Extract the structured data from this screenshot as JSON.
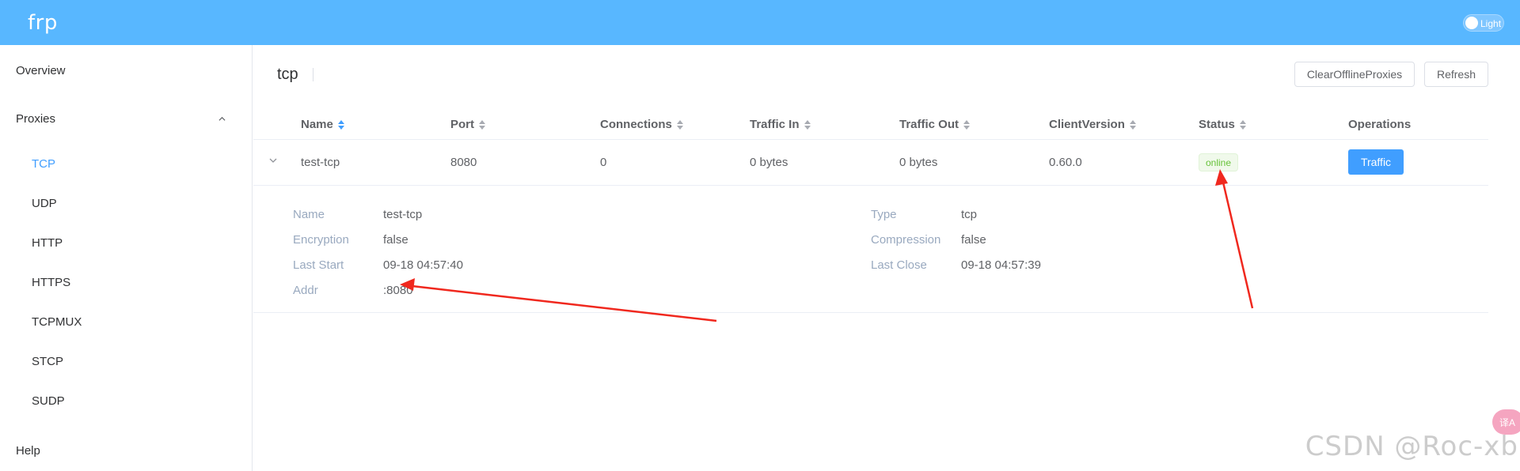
{
  "header": {
    "brand": "frp",
    "theme_toggle_label": "Light"
  },
  "sidebar": {
    "overview": "Overview",
    "proxies": "Proxies",
    "proxy_types": [
      "TCP",
      "UDP",
      "HTTP",
      "HTTPS",
      "TCPMUX",
      "STCP",
      "SUDP"
    ],
    "active_type": "TCP",
    "help": "Help"
  },
  "page": {
    "title": "tcp",
    "clear_button": "ClearOfflineProxies",
    "refresh_button": "Refresh"
  },
  "table": {
    "columns": [
      "Name",
      "Port",
      "Connections",
      "Traffic In",
      "Traffic Out",
      "ClientVersion",
      "Status",
      "Operations"
    ],
    "rows": [
      {
        "name": "test-tcp",
        "port": "8080",
        "connections": "0",
        "traffic_in": "0 bytes",
        "traffic_out": "0 bytes",
        "client_version": "0.60.0",
        "status": "online",
        "operation": "Traffic"
      }
    ]
  },
  "details": {
    "name_label": "Name",
    "name_value": "test-tcp",
    "type_label": "Type",
    "type_value": "tcp",
    "encryption_label": "Encryption",
    "encryption_value": "false",
    "compression_label": "Compression",
    "compression_value": "false",
    "last_start_label": "Last Start",
    "last_start_value": "09-18 04:57:40",
    "last_close_label": "Last Close",
    "last_close_value": "09-18 04:57:39",
    "addr_label": "Addr",
    "addr_value": ":8080"
  },
  "overlay": {
    "watermark": "CSDN @Roc-xb",
    "translate_glyph": "译A"
  },
  "colors": {
    "header_bg": "#58b7ff",
    "accent": "#409eff",
    "status_online": "#67c23a",
    "annotation_arrow": "#f0281e"
  }
}
